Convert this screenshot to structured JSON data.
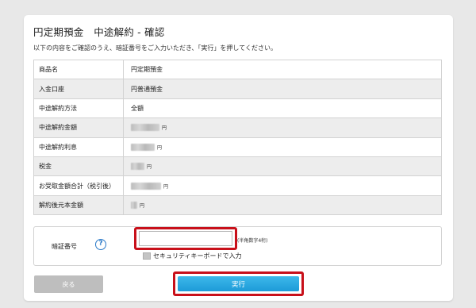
{
  "header": {
    "title": "円定期預金　中途解約 - 確認",
    "instruction": "以下の内容をご確認のうえ、暗証番号をご入力いただき、「実行」を押してください。"
  },
  "details": {
    "rows": [
      {
        "label": "商品名",
        "value": "円定期預金"
      },
      {
        "label": "入金口座",
        "value": "円普通預金"
      },
      {
        "label": "中途解約方法",
        "value": "全額"
      },
      {
        "label": "中途解約金額",
        "value": "",
        "unit": "円"
      },
      {
        "label": "中途解約利息",
        "value": "",
        "unit": "円"
      },
      {
        "label": "税金",
        "value": "",
        "unit": "円"
      },
      {
        "label": "お受取金額合計（税引後）",
        "value": "",
        "unit": "円"
      },
      {
        "label": "解約後元本金額",
        "value": "",
        "unit": "円"
      }
    ]
  },
  "pin": {
    "label": "暗証番号",
    "help_icon": "question-circle-icon",
    "value": "",
    "note": "(半角数字4桁)",
    "keyboard_label": "セキュリティキーボードで入力",
    "keyboard_checked": false
  },
  "actions": {
    "back_label": "戻る",
    "execute_label": "実行"
  },
  "colors": {
    "highlight": "#c8101a",
    "execute_button": "#1d9bd8",
    "back_button": "#bebebe",
    "shaded_row": "#ededed",
    "help_icon": "#2878c8"
  }
}
